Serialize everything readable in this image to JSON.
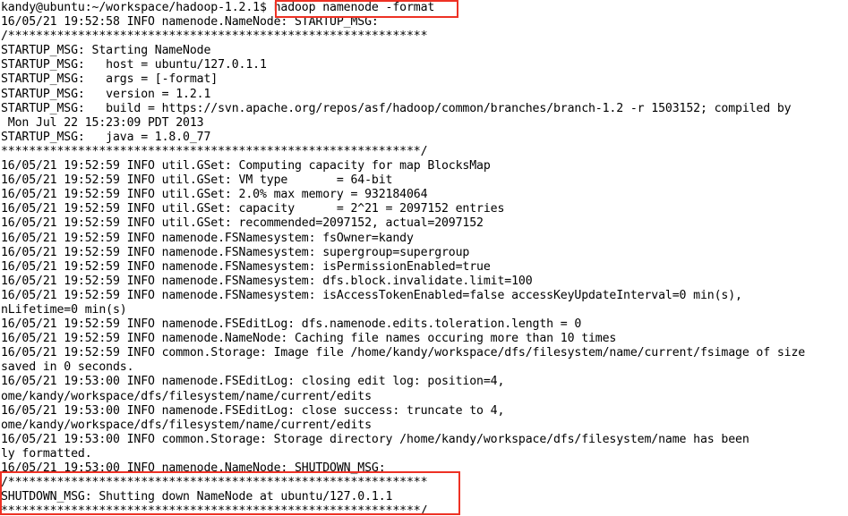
{
  "terminal": {
    "window_title": "hadoop namenode -format",
    "background_color": "#ffffff",
    "foreground_color": "#000000",
    "prompt": "kandy@ubuntu:~/workspace/hadoop-1.2.1$",
    "user": "kandy",
    "host": "ubuntu",
    "cwd": "~/workspace/hadoop-1.2.1",
    "command": "hadoop namenode -format"
  },
  "annotations": {
    "highlight_color": "#ee3124",
    "boxes": [
      {
        "name": "command-box",
        "target": "hadoop namenode -format"
      },
      {
        "name": "shutdown-box",
        "target": "SHUTDOWN_MSG: Shutting down NameNode at ubuntu/127.0.1.1"
      }
    ]
  },
  "output": {
    "lines": [
      "kandy@ubuntu:~/workspace/hadoop-1.2.1$ hadoop namenode -format",
      "16/05/21 19:52:58 INFO namenode.NameNode: STARTUP_MSG:",
      "/************************************************************",
      "STARTUP_MSG: Starting NameNode",
      "STARTUP_MSG:   host = ubuntu/127.0.1.1",
      "STARTUP_MSG:   args = [-format]",
      "STARTUP_MSG:   version = 1.2.1",
      "STARTUP_MSG:   build = https://svn.apache.org/repos/asf/hadoop/common/branches/branch-1.2 -r 1503152; compiled by",
      " Mon Jul 22 15:23:09 PDT 2013",
      "STARTUP_MSG:   java = 1.8.0_77",
      "************************************************************/",
      "16/05/21 19:52:59 INFO util.GSet: Computing capacity for map BlocksMap",
      "16/05/21 19:52:59 INFO util.GSet: VM type       = 64-bit",
      "16/05/21 19:52:59 INFO util.GSet: 2.0% max memory = 932184064",
      "16/05/21 19:52:59 INFO util.GSet: capacity      = 2^21 = 2097152 entries",
      "16/05/21 19:52:59 INFO util.GSet: recommended=2097152, actual=2097152",
      "16/05/21 19:52:59 INFO namenode.FSNamesystem: fsOwner=kandy",
      "16/05/21 19:52:59 INFO namenode.FSNamesystem: supergroup=supergroup",
      "16/05/21 19:52:59 INFO namenode.FSNamesystem: isPermissionEnabled=true",
      "16/05/21 19:52:59 INFO namenode.FSNamesystem: dfs.block.invalidate.limit=100",
      "16/05/21 19:52:59 INFO namenode.FSNamesystem: isAccessTokenEnabled=false accessKeyUpdateInterval=0 min(s),",
      "nLifetime=0 min(s)",
      "16/05/21 19:52:59 INFO namenode.FSEditLog: dfs.namenode.edits.toleration.length = 0",
      "16/05/21 19:52:59 INFO namenode.NameNode: Caching file names occuring more than 10 times",
      "16/05/21 19:52:59 INFO common.Storage: Image file /home/kandy/workspace/dfs/filesystem/name/current/fsimage of size",
      "saved in 0 seconds.",
      "16/05/21 19:53:00 INFO namenode.FSEditLog: closing edit log: position=4,",
      "ome/kandy/workspace/dfs/filesystem/name/current/edits",
      "16/05/21 19:53:00 INFO namenode.FSEditLog: close success: truncate to 4,",
      "ome/kandy/workspace/dfs/filesystem/name/current/edits",
      "16/05/21 19:53:00 INFO common.Storage: Storage directory /home/kandy/workspace/dfs/filesystem/name has been",
      "ly formatted.",
      "16/05/21 19:53:00 INFO namenode.NameNode: SHUTDOWN_MSG:",
      "/************************************************************",
      "SHUTDOWN_MSG: Shutting down NameNode at ubuntu/127.0.1.1",
      "************************************************************/"
    ]
  }
}
